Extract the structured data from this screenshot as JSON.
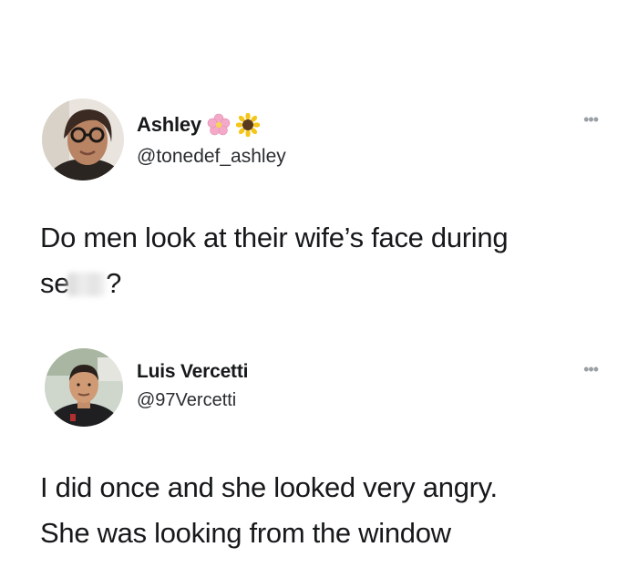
{
  "tweets": [
    {
      "display_name": "Ashley",
      "handle": "@tonedef_ashley",
      "name_emojis": [
        "cherry-blossom-icon",
        "sunflower-icon"
      ],
      "text_line1": "Do men look at their wife’s face during",
      "text_line2_visible": "se",
      "text_line2_end": "?",
      "more_glyph": "•••"
    },
    {
      "display_name": "Luis Vercetti",
      "handle": "@97Vercetti",
      "text_line1": "I did once and she looked very angry.",
      "text_line2": "She was looking from the window",
      "more_glyph": "•••"
    }
  ],
  "colors": {
    "background": "#ffffff",
    "text": "#16181a",
    "secondary": "#9aa0a6"
  }
}
